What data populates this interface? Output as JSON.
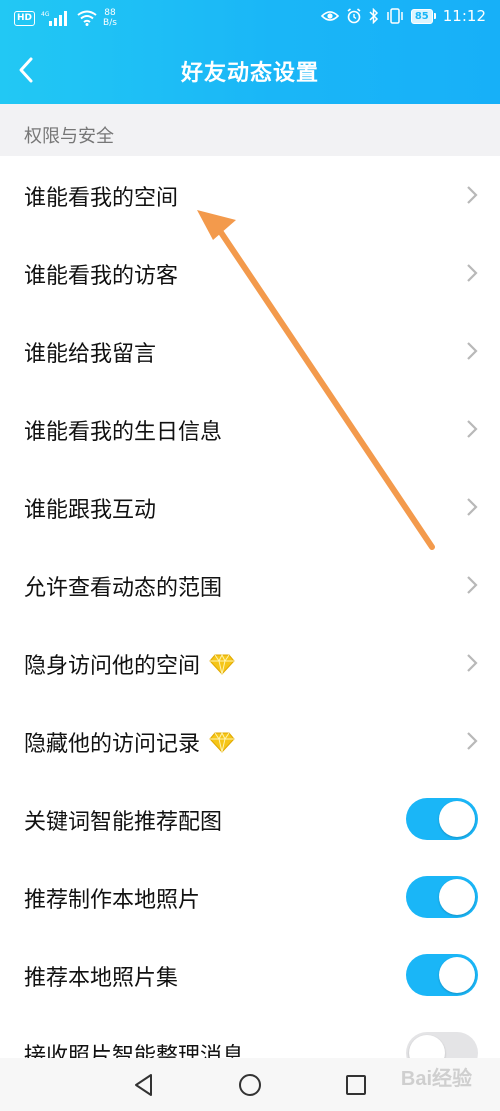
{
  "status_bar": {
    "hd_badge": "HD",
    "network": "4G",
    "speed_value": "88",
    "speed_unit": "B/s",
    "battery": "85",
    "time": "11:12"
  },
  "header": {
    "title": "好友动态设置"
  },
  "section": {
    "title": "权限与安全"
  },
  "rows": [
    {
      "label": "谁能看我的空间",
      "control": "chevron"
    },
    {
      "label": "谁能看我的访客",
      "control": "chevron"
    },
    {
      "label": "谁能给我留言",
      "control": "chevron"
    },
    {
      "label": "谁能看我的生日信息",
      "control": "chevron"
    },
    {
      "label": "谁能跟我互动",
      "control": "chevron"
    },
    {
      "label": "允许查看动态的范围",
      "control": "chevron"
    },
    {
      "label": "隐身访问他的空间",
      "control": "chevron",
      "vip": true
    },
    {
      "label": "隐藏他的访问记录",
      "control": "chevron",
      "vip": true
    },
    {
      "label": "关键词智能推荐配图",
      "control": "toggle",
      "on": true
    },
    {
      "label": "推荐制作本地照片",
      "control": "toggle",
      "on": true
    },
    {
      "label": "推荐本地照片集",
      "control": "toggle",
      "on": true
    },
    {
      "label": "接收照片智能整理消息",
      "control": "toggle",
      "on": false
    }
  ],
  "watermark": "Bai经验",
  "colors": {
    "accent": "#1ab6f7",
    "arrow": "#f39a4c",
    "vip_gem": "#f5c518"
  }
}
